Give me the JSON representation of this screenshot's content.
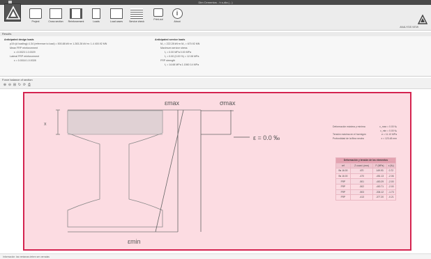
{
  "window": {
    "title": "Dim Cementos - h s-dia (...)"
  },
  "ribbon": {
    "buttons": [
      {
        "label": "Project",
        "icon": "project-icon"
      },
      {
        "label": "Cross section",
        "icon": "cross-section-icon"
      },
      {
        "label": "Reinforcement",
        "icon": "reinforcement-icon"
      },
      {
        "label": "Loads",
        "icon": "loads-icon"
      },
      {
        "label": "Load cases",
        "icon": "load-cases-icon"
      },
      {
        "label": "Service check",
        "icon": "service-check-icon"
      },
      {
        "label": "Print-out",
        "icon": "print-icon"
      },
      {
        "label": "About",
        "icon": "info-icon"
      }
    ],
    "right_text": "ANALYSIS VIEW"
  },
  "results": {
    "header": "Results",
    "left": {
      "title": "Anticipated design loads",
      "lines": [
        "p10=(d loading)=1.34 (reference to load) = 500.88 kN·m 1.283.28 kN·m: 1.4 400.92 MN",
        "Mean FRP reinforcement",
        "ε =0.0023 1.0.0029",
        "Lateral FRP reinforcement",
        "ε = 0.0018 1.0.0028"
      ]
    },
    "right": {
      "title": "Anticipated service loads",
      "lines": [
        "M₀ = 222.28 kN·m  M₀ = 670.92 MN",
        "Maximum service stress",
        "f₁ = 0.00 MPa 0.00 MPa",
        "f₁ = 0.00 (0.00 %) = 12.08 MPa",
        "FRP strength",
        "f₁ = 14.68 MPa 1.1560 14 MPa"
      ]
    }
  },
  "section_panel": {
    "header": "Force balance of section",
    "tools": [
      "zoom-in-icon",
      "zoom-out-icon",
      "fit-icon",
      "rotate-icon",
      "refresh-icon",
      "print-icon"
    ]
  },
  "diagram": {
    "label_emax": "εmax",
    "label_sigmax": "σmax",
    "label_emin": "εmin",
    "label_strain": "ε = 0.0 ‰",
    "label_x": "x"
  },
  "info": {
    "rows": [
      {
        "label": "Deformación máxima y mínima",
        "value": "ε_max = 0.00 ‰"
      },
      {
        "label": "",
        "value": "ε_min = 0.00 ‰"
      },
      {
        "label": "Tensión máxima en el hormigón",
        "value": "σ = 11.10 MPa"
      },
      {
        "label": "Profundidad de la fibra neutra",
        "value": "x = 123.48 mm"
      }
    ]
  },
  "table": {
    "caption": "Deformación y tensión de los elementos",
    "headers": [
      "ref",
      "Z coord. (mm)",
      "F (MPa)",
      "ε (‰)"
    ],
    "rows": [
      [
        "Bs 16.00",
        "470",
        "149.93",
        "0.72"
      ],
      [
        "Bs 16.00",
        "-470",
        "-451.13",
        "-2.06"
      ],
      [
        "FRP",
        "-501",
        "-400.29",
        "-2.00"
      ],
      [
        "FRP",
        "-502",
        "-400.71",
        "-2.00"
      ],
      [
        "FRP",
        "-503",
        "-334.12",
        "-1.73"
      ],
      [
        "FRP",
        "-413",
        "-377.20",
        "-0.21"
      ]
    ]
  },
  "status": {
    "text": "Información: las ventanas deben ser cerradas"
  },
  "colors": {
    "accent": "#d4234f",
    "canvas_bg": "#fcdce2"
  }
}
